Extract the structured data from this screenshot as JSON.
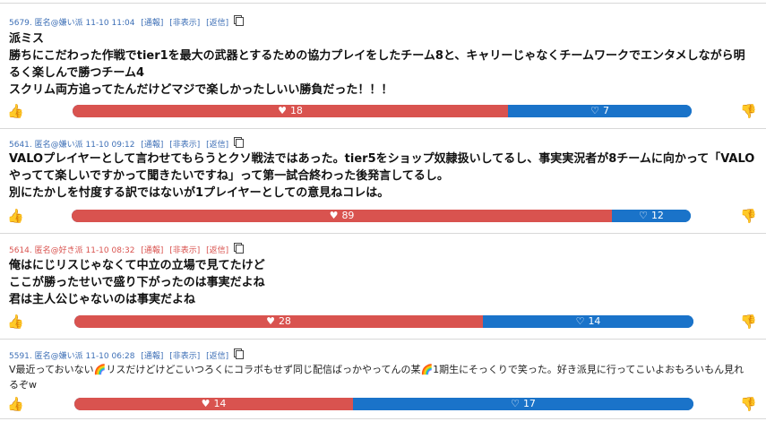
{
  "colors": {
    "like": "#d9534f",
    "dislike": "#1a73c9",
    "meta_anti": "#3d6fb6",
    "meta_pro": "#d9534f",
    "thumb_down": "#52a7d8"
  },
  "icons": {
    "thumbs_up": "thumbs-up-icon",
    "thumbs_down": "thumbs-down-icon",
    "heart": "heart-icon",
    "broken_heart": "broken-heart-icon",
    "copy": "copy-icon"
  },
  "comments": [
    {
      "header": "5679. 匿名@嫌い派 11-10 11:04",
      "report": "[通報]",
      "hide": "[非表示]",
      "reply": "[返信]",
      "lines": [
        "派ミス",
        "勝ちにこだわった作戦でtier1を最大の武器とするための協力プレイをしたチーム8と、キャリーじゃなくチームワークでエンタメしながら明",
        "るく楽しんで勝つチーム4",
        "スクリム両方追ってたんだけどマジで楽しかったしいい勝負だった！！！"
      ],
      "likes": "18",
      "dislikes": "7",
      "like_ratio": 0.704
    },
    {
      "header": "5641. 匿名@嫌い派 11-10 09:12",
      "report": "[通報]",
      "hide": "[非表示]",
      "reply": "[返信]",
      "lines": [
        "VALOプレイヤーとして言わせてもらうとクソ戦法ではあった。tier5をショップ奴隷扱いしてるし、事実実況者が8チームに向かって「VALO",
        "やってて楽しいですかって聞きたいですね」って第一試合終わった後発言してるし。",
        "別にたかしを忖度する訳ではないが1プレイヤーとしての意見ねコレは。"
      ],
      "likes": "89",
      "dislikes": "12",
      "like_ratio": 0.872
    },
    {
      "header": "5614. 匿名@好き派 11-10 08:32",
      "report": "[通報]",
      "hide": "[非表示]",
      "reply": "[返信]",
      "lines": [
        "俺はにじリスじゃなくて中立の立場で見てたけど",
        "ここが勝ったせいで盛り下がったのは事実だよね",
        "君は主人公じゃないのは事実だよね"
      ],
      "likes": "28",
      "dislikes": "14",
      "like_ratio": 0.66
    },
    {
      "header": "5591. 匿名@嫌い派 11-10 06:28",
      "report": "[通報]",
      "hide": "[非表示]",
      "reply": "[返信]",
      "lines": [
        "V最近っておいない🌈リスだけどけどこいつろくにコラボもせず同じ配信ばっかやってんの某🌈1期生にそっくりで笑った。好き派見に行ってこいよおもろいもん見れ",
        "るぞw"
      ],
      "likes": "14",
      "dislikes": "17",
      "like_ratio": 0.45
    }
  ]
}
